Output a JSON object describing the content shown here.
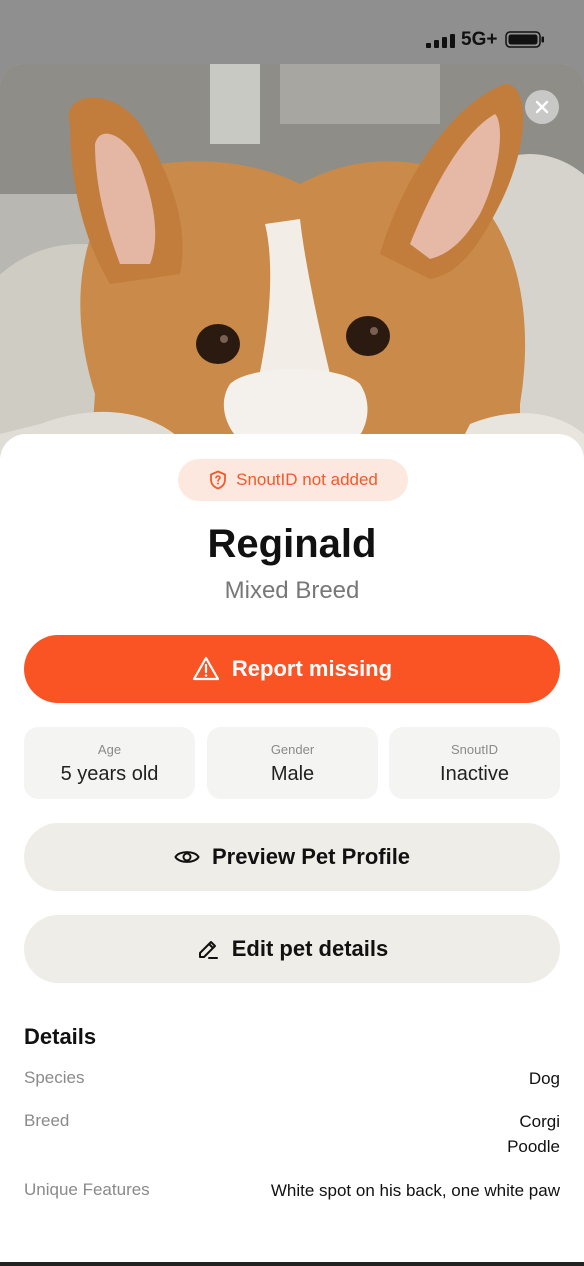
{
  "status_bar": {
    "network": "5G+"
  },
  "header": {
    "close_icon": "close-icon"
  },
  "badge": {
    "icon": "shield-question-icon",
    "label": "SnoutID not added"
  },
  "pet": {
    "name": "Reginald",
    "breed": "Mixed Breed"
  },
  "report_button": {
    "icon": "warning-triangle-icon",
    "label": "Report missing"
  },
  "stats": [
    {
      "label": "Age",
      "value": "5 years old"
    },
    {
      "label": "Gender",
      "value": "Male"
    },
    {
      "label": "SnoutID",
      "value": "Inactive"
    }
  ],
  "preview_button": {
    "icon": "eye-icon",
    "label": "Preview Pet Profile"
  },
  "edit_button": {
    "icon": "edit-pencil-icon",
    "label": "Edit pet details"
  },
  "details": {
    "title": "Details",
    "rows": [
      {
        "label": "Species",
        "value": "Dog"
      },
      {
        "label": "Breed",
        "value": "Corgi\nPoodle"
      },
      {
        "label": "Unique Features",
        "value": "White spot on his back, one white paw"
      }
    ]
  },
  "colors": {
    "accent": "#fa5424",
    "badge_bg": "#fde8e0",
    "button_bg": "#efede8"
  }
}
